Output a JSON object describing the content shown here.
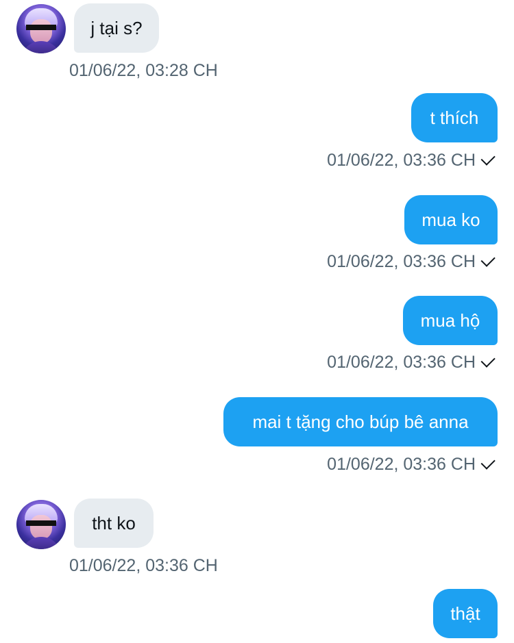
{
  "messages": [
    {
      "side": "in",
      "text": "j tại s?",
      "time": "01/06/22, 03:28 CH"
    },
    {
      "side": "out",
      "text": "t thích",
      "time": "01/06/22, 03:36 CH"
    },
    {
      "side": "out",
      "text": "mua ko",
      "time": "01/06/22, 03:36 CH"
    },
    {
      "side": "out",
      "text": "mua hộ",
      "time": "01/06/22, 03:36 CH"
    },
    {
      "side": "out",
      "text": "mai t tặng cho búp bê anna",
      "time": "01/06/22, 03:36 CH"
    },
    {
      "side": "in",
      "text": "tht ko",
      "time": "01/06/22, 03:36 CH"
    },
    {
      "side": "out",
      "text": "thật",
      "time": ""
    }
  ],
  "colors": {
    "outgoing_bubble": "#1da1f2",
    "incoming_bubble": "#e7ecf0",
    "timestamp": "#536471"
  },
  "icons": {
    "sent": "checkmark-icon",
    "avatar": "user-avatar"
  }
}
